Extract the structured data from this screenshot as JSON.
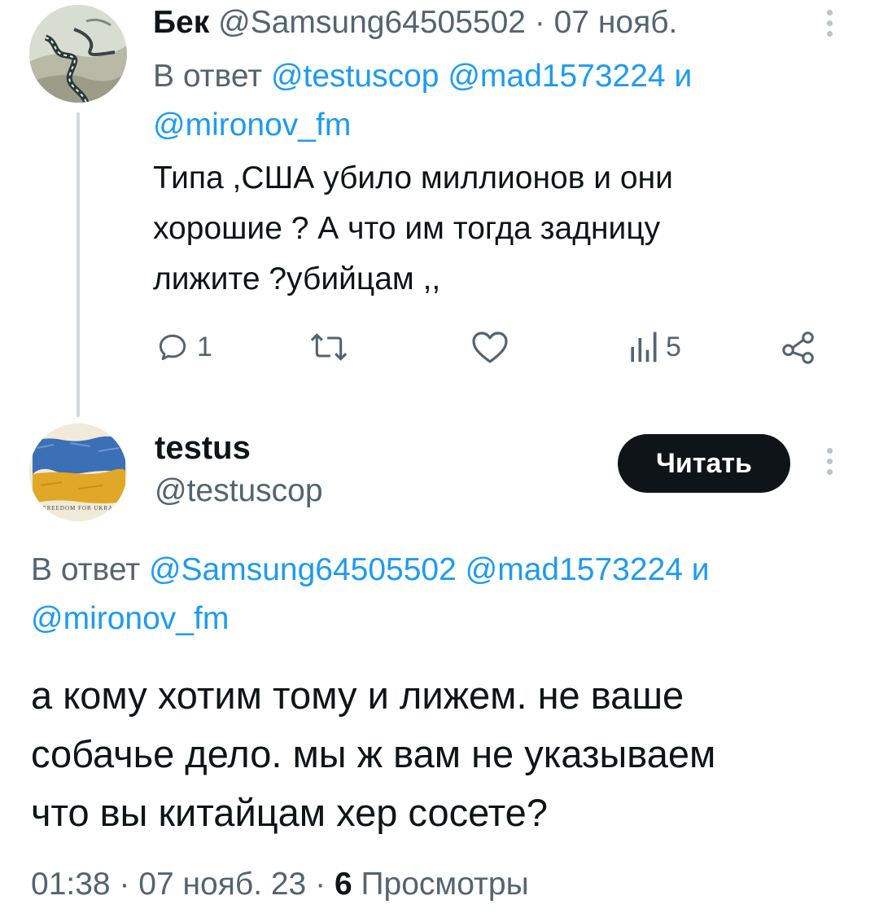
{
  "tweet1": {
    "name": "Бек",
    "handle": "@Samsung64505502",
    "date": "07 нояб.",
    "separator": "·",
    "reply_prefix": "В ответ",
    "reply_mentions": [
      "@testuscop",
      "@mad1573224"
    ],
    "reply_and": "и",
    "reply_last_mention": "@mironov_fm",
    "body_lines": [
      "Типа ,США убило миллионов и они",
      "хорошие ? А что им тогда задницу",
      "лижите ?убийцам ,,"
    ],
    "actions": {
      "replies": "1",
      "retweets": "",
      "likes": "",
      "views": "5"
    },
    "avatar_icon": "road-landscape-avatar"
  },
  "tweet2": {
    "name": "testus",
    "handle": "@testuscop",
    "follow_label": "Читать",
    "avatar_caption": "FREEDOM FOR UKRA",
    "avatar_icon": "ukraine-flag-avatar",
    "reply_prefix": "В ответ",
    "reply_mentions": [
      "@Samsung64505502",
      "@mad1573224"
    ],
    "reply_and": "и",
    "reply_last_mention": "@mironov_fm",
    "body_lines": [
      "а кому хотим тому и лижем. не ваше",
      "собачье дело. мы ж вам не указываем",
      "что вы китайцам хер сосете?"
    ],
    "time": "01:38",
    "date": "07 нояб. 23",
    "separator": "·",
    "views_count": "6",
    "views_label": "Просмотры"
  },
  "colors": {
    "link": "#1d9bf0",
    "muted": "#536471",
    "text": "#0f1419",
    "thread_line": "#cfd9de",
    "button_bg": "#0f1419",
    "button_text": "#ffffff",
    "flag_blue": "#3b6fb6",
    "flag_yellow": "#e0a826"
  }
}
